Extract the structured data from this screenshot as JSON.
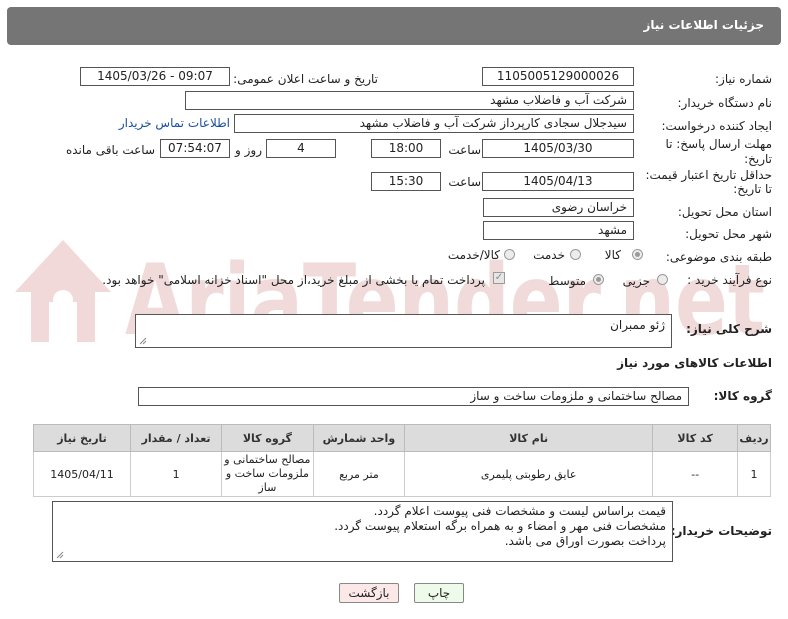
{
  "header": {
    "title": "جزئیات اطلاعات نیاز"
  },
  "fields": {
    "need_number_label": "شماره نیاز:",
    "need_number": "1105005129000026",
    "announce_label": "تاریخ و ساعت اعلان عمومی:",
    "announce_value": "1405/03/26 - 09:07",
    "buyer_org_label": "نام دستگاه خریدار:",
    "buyer_org": "شرکت آب و فاضلاب مشهد",
    "requester_label": "ایجاد کننده درخواست:",
    "requester": "سیدجلال سجادی کارپرداز شرکت آب و فاضلاب مشهد",
    "contact_link": "اطلاعات تماس خریدار",
    "reply_deadline_label_1": "مهلت ارسال پاسخ: تا",
    "reply_deadline_label_2": "تاریخ:",
    "reply_date": "1405/03/30",
    "time_label": "ساعت",
    "reply_time": "18:00",
    "days_value": "4",
    "days_label": "روز و",
    "remaining_time": "07:54:07",
    "remaining_label": "ساعت باقی مانده",
    "price_deadline_label_1": "حداقل تاریخ اعتبار قیمت:",
    "price_deadline_label_2": "تا تاریخ:",
    "price_date": "1405/04/13",
    "price_time": "15:30",
    "province_label": "استان محل تحویل:",
    "province": "خراسان رضوی",
    "city_label": "شهر محل تحویل:",
    "city": "مشهد",
    "category_label": "طبقه بندی موضوعی:",
    "category_options": [
      "کالا",
      "خدمت",
      "کالا/خدمت"
    ],
    "process_label": "نوع فرآیند خرید :",
    "process_options": [
      "جزیی",
      "متوسط"
    ],
    "payment_text": "پرداخت تمام یا بخشی از مبلغ خرید،از محل \"اسناد خزانه اسلامی\" خواهد بود."
  },
  "description": {
    "label": "شرح کلی نیاز:",
    "value": "ژئو ممبران"
  },
  "goods": {
    "section_title": "اطلاعات کالاهای مورد نیاز",
    "group_label": "گروه کالا:",
    "group_value": "مصالح ساختمانی و ملزومات ساخت و ساز",
    "table": {
      "headers": [
        "ردیف",
        "کد کالا",
        "نام کالا",
        "واحد شمارش",
        "گروه کالا",
        "تعداد / مقدار",
        "تاریخ نیاز"
      ],
      "rows": [
        {
          "row": "1",
          "code": "--",
          "name": "عایق رطوبتی پلیمری",
          "unit": "متر مربع",
          "group": "مصالح ساختمانی و ملزومات ساخت و ساز",
          "qty": "1",
          "date": "1405/04/11"
        }
      ]
    }
  },
  "buyer_notes": {
    "label": "توضیحات خریدار:",
    "lines": [
      "قیمت براساس لیست و مشخصات فنی پیوست اعلام گردد.",
      "مشخصات فنی مهر و امضاء و به همراه برگه استعلام پیوست گردد.",
      "پرداخت بصورت اوراق می باشد."
    ]
  },
  "buttons": {
    "print": "چاپ",
    "back": "بازگشت"
  },
  "watermark": {
    "text": "AriaTender.net",
    "color": "#e9c9c9"
  }
}
